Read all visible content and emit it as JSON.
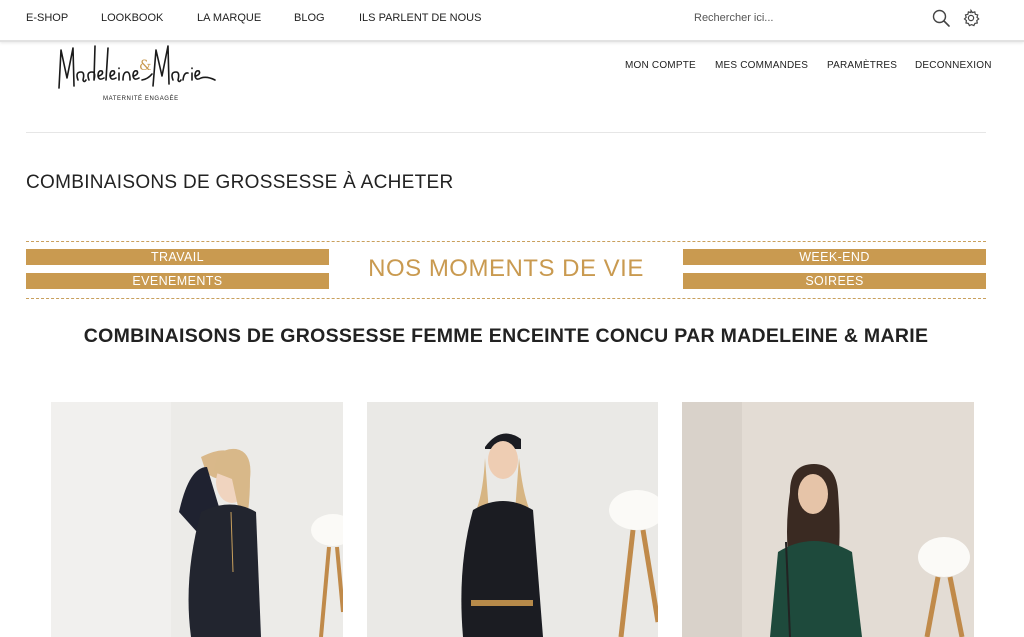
{
  "top_nav": {
    "items": [
      "E-SHOP",
      "LOOKBOOK",
      "LA MARQUE",
      "BLOG",
      "ILS PARLENT DE NOUS"
    ],
    "search_placeholder": "Rechercher ici..."
  },
  "brand": {
    "logo_text": "Madeleine & Marie",
    "tagline": "MATERNITÉ ENGAGÉE"
  },
  "account_nav": [
    "MON COMPTE",
    "MES COMMANDES",
    "PARAMÈTRES",
    "DECONNEXION"
  ],
  "page_title": "COMBINAISONS DE GROSSESSE À ACHETER",
  "moments": {
    "title": "NOS MOMENTS DE VIE",
    "left": [
      "TRAVAIL",
      "EVENEMENTS"
    ],
    "right": [
      "WEEK-END",
      "SOIREES"
    ]
  },
  "sub_heading": "COMBINAISONS DE GROSSESSE FEMME ENCEINTE CONCU PAR MADELEINE & MARIE",
  "colors": {
    "accent": "#c99a50",
    "text": "#222222",
    "background": "#ffffff"
  },
  "icons": [
    "search-icon",
    "gear-icon"
  ]
}
